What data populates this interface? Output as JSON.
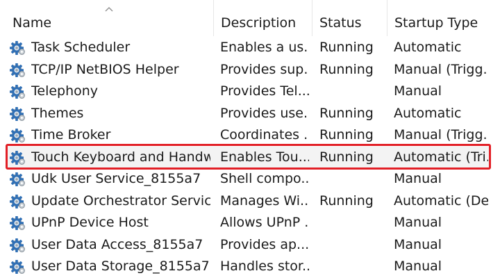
{
  "colors": {
    "highlight_border": "#e21f26",
    "selected_row_bg": "#f3f3f3",
    "gear_blue": "#2f6fb5",
    "gear_gray": "#9aa4ad"
  },
  "table": {
    "sort_indicator_icon": "sort-ascending-icon",
    "columns": [
      {
        "key": "name",
        "label": "Name"
      },
      {
        "key": "description",
        "label": "Description"
      },
      {
        "key": "status",
        "label": "Status"
      },
      {
        "key": "startup",
        "label": "Startup Type"
      }
    ],
    "row_icon": "service-gear-icon",
    "rows": [
      {
        "name": "Task Scheduler",
        "description": "Enables a us...",
        "status": "Running",
        "startup": "Automatic"
      },
      {
        "name": "TCP/IP NetBIOS Helper",
        "description": "Provides sup...",
        "status": "Running",
        "startup": "Manual (Trigg..."
      },
      {
        "name": "Telephony",
        "description": "Provides Tel...",
        "status": "",
        "startup": "Manual"
      },
      {
        "name": "Themes",
        "description": "Provides use...",
        "status": "Running",
        "startup": "Automatic"
      },
      {
        "name": "Time Broker",
        "description": "Coordinates ...",
        "status": "Running",
        "startup": "Manual (Trigg..."
      },
      {
        "name": "Touch Keyboard and Handw...",
        "description": "Enables Tou...",
        "status": "Running",
        "startup": "Automatic (Tri...",
        "selected": true
      },
      {
        "name": "Udk User Service_8155a7",
        "description": "Shell compo...",
        "status": "",
        "startup": "Manual"
      },
      {
        "name": "Update Orchestrator Service",
        "description": "Manages Wi...",
        "status": "Running",
        "startup": "Automatic (De..."
      },
      {
        "name": "UPnP Device Host",
        "description": "Allows UPnP ...",
        "status": "",
        "startup": "Manual"
      },
      {
        "name": "User Data Access_8155a7",
        "description": "Provides ap...",
        "status": "",
        "startup": "Manual"
      },
      {
        "name": "User Data Storage_8155a7",
        "description": "Handles stor...",
        "status": "",
        "startup": "Manual"
      }
    ]
  }
}
